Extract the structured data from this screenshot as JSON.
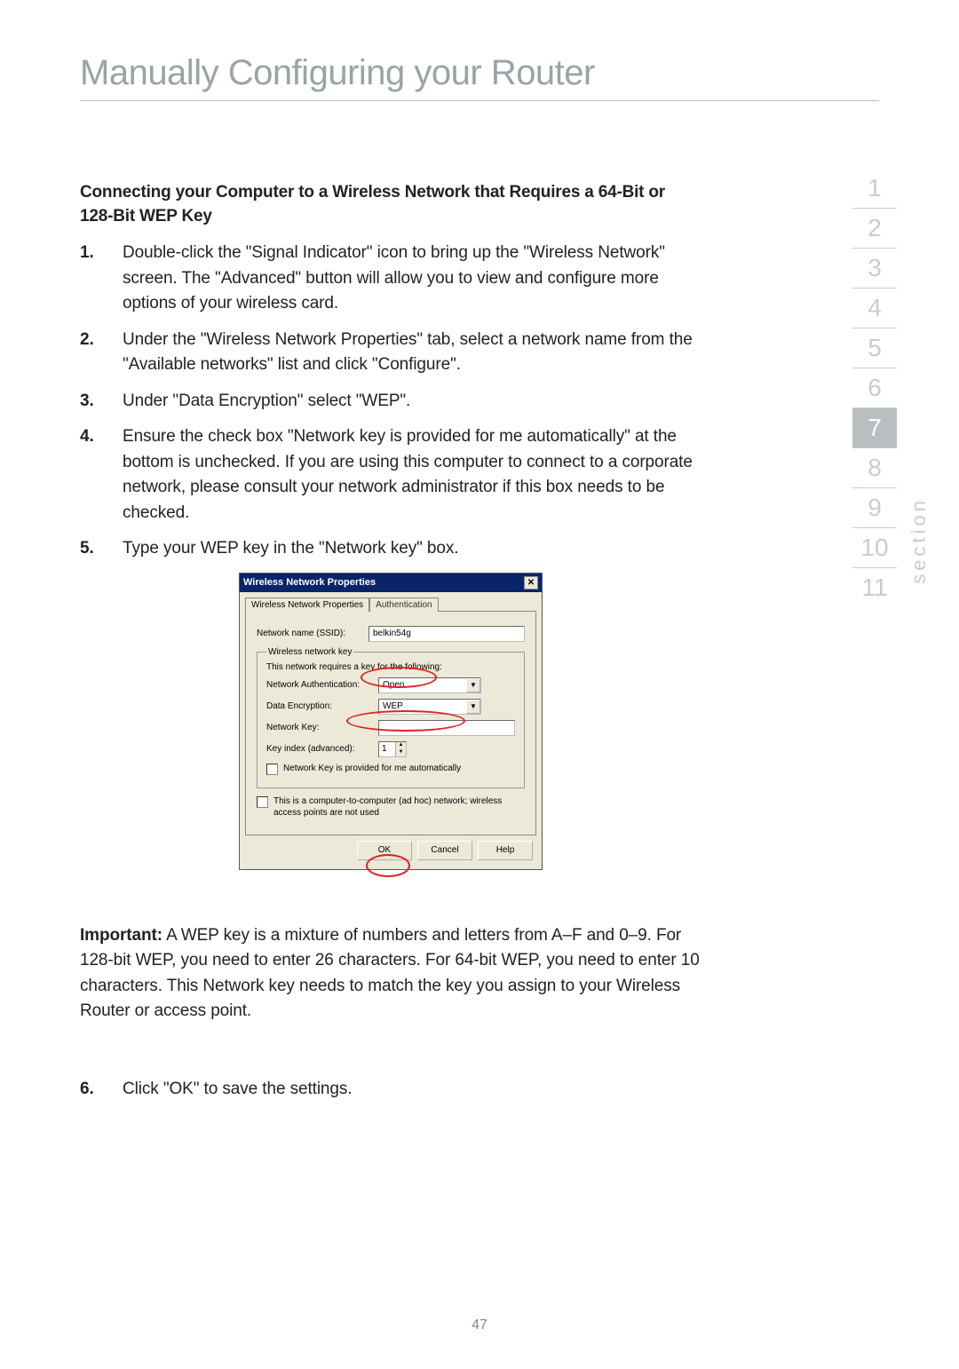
{
  "page_title": "Manually Configuring your Router",
  "subhead": "Connecting your Computer to a Wireless Network that Requires a 64-Bit or 128-Bit WEP Key",
  "steps": [
    "Double-click the \"Signal Indicator\" icon to bring up the \"Wireless Network\" screen. The \"Advanced\" button will allow you to view and configure more options of your wireless card.",
    "Under the \"Wireless Network Properties\" tab, select a network name from the \"Available networks\" list and click \"Configure\".",
    "Under \"Data Encryption\" select \"WEP\".",
    "Ensure the check box \"Network key is provided for me automatically\" at the bottom is unchecked. If you are using this computer to connect to a corporate network, please consult your network administrator if this box needs to be checked.",
    "Type your WEP key in the \"Network key\" box."
  ],
  "important_lead": "Important:",
  "important_body": " A WEP key is a mixture of numbers and letters from A–F and 0–9. For 128-bit WEP, you need to enter 26 characters. For 64-bit WEP, you need to enter 10 characters. This Network key needs to match the key you assign to your Wireless Router or access point.",
  "step6_num": "6.",
  "step6_text": "Click \"OK\" to save the settings.",
  "page_number": "47",
  "side_nav": [
    "1",
    "2",
    "3",
    "4",
    "5",
    "6",
    "7",
    "8",
    "9",
    "10",
    "11"
  ],
  "side_nav_active": "7",
  "section_label": "section",
  "dialog": {
    "title": "Wireless Network Properties",
    "tab1": "Wireless Network Properties",
    "tab2": "Authentication",
    "ssid_label": "Network name (SSID):",
    "ssid_value": "belkin54g",
    "fieldset": "Wireless network key",
    "requires": "This network requires a key for the following:",
    "auth_label": "Network Authentication:",
    "auth_value": "Open",
    "enc_label": "Data Encryption:",
    "enc_value": "WEP",
    "key_label": "Network Key:",
    "key_value": "",
    "keyindex_label": "Key index (advanced):",
    "keyindex_value": "1",
    "auto_cb": "Network Key is provided for me automatically",
    "adhoc_cb": "This is a computer-to-computer (ad hoc) network; wireless access points are not used",
    "btn_ok": "OK",
    "btn_cancel": "Cancel",
    "btn_help": "Help"
  }
}
